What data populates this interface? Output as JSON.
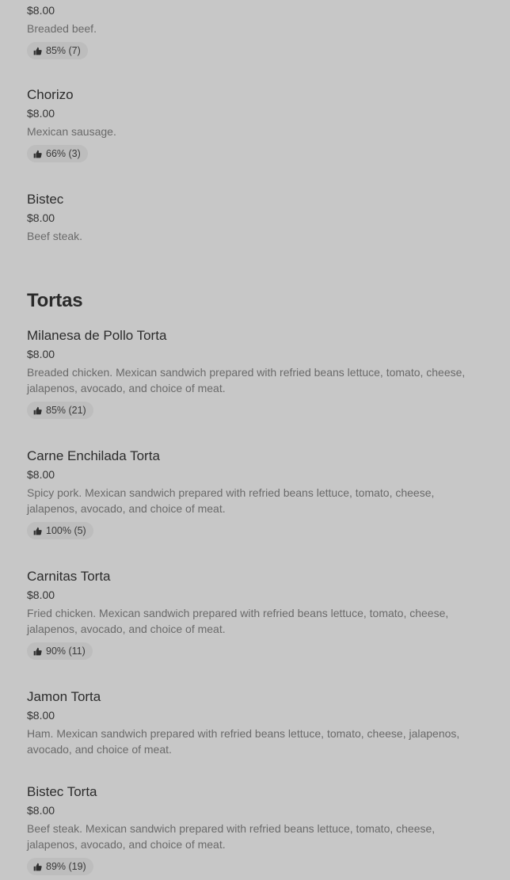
{
  "top_partial_item": {
    "price": "$8.00",
    "description": "Breaded beef.",
    "rating": "85% (7)"
  },
  "items_before": [
    {
      "name": "Chorizo",
      "price": "$8.00",
      "description": "Mexican sausage.",
      "rating": "66% (3)"
    },
    {
      "name": "Bistec",
      "price": "$8.00",
      "description": "Beef steak."
    }
  ],
  "section": {
    "title": "Tortas"
  },
  "tortas": [
    {
      "name": "Milanesa de Pollo Torta",
      "price": "$8.00",
      "description": "Breaded chicken. Mexican sandwich prepared with refried beans lettuce, tomato, cheese, jalapenos, avocado, and choice of meat.",
      "rating": "85% (21)"
    },
    {
      "name": "Carne Enchilada Torta",
      "price": "$8.00",
      "description": "Spicy pork. Mexican sandwich prepared with refried beans lettuce, tomato, cheese, jalapenos, avocado, and choice of meat.",
      "rating": "100% (5)"
    },
    {
      "name": "Carnitas Torta",
      "price": "$8.00",
      "description": "Fried chicken. Mexican sandwich prepared with refried beans lettuce, tomato, cheese, jalapenos, avocado, and choice of meat.",
      "rating": "90% (11)"
    },
    {
      "name": "Jamon Torta",
      "price": "$8.00",
      "description": "Ham. Mexican sandwich prepared with refried beans lettuce, tomato, cheese, jalapenos, avocado, and choice of meat."
    },
    {
      "name": "Bistec Torta",
      "price": "$8.00",
      "description": "Beef steak. Mexican sandwich prepared with refried beans lettuce, tomato, cheese, jalapenos, avocado, and choice of meat.",
      "rating": "89% (19)"
    }
  ],
  "icons": {
    "rating": "thumbs-up-icon"
  }
}
